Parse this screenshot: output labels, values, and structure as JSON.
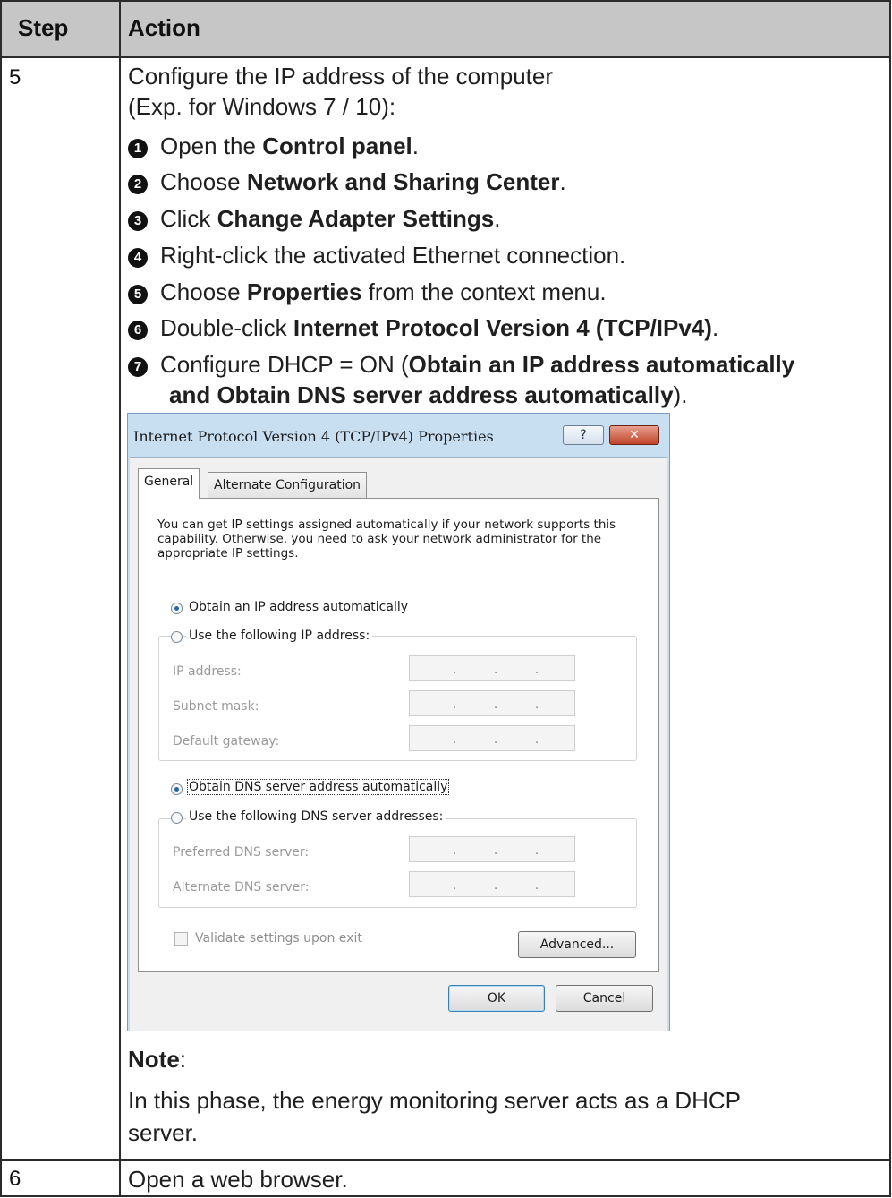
{
  "header": {
    "step": "Step",
    "action": "Action"
  },
  "rows": [
    {
      "step": "5",
      "intro": [
        "Configure the IP address of the computer",
        "(Exp. for Windows 7 / 10):"
      ],
      "items": [
        {
          "bullet": "1",
          "pre": "Open the ",
          "bold": "Control panel",
          "post": "."
        },
        {
          "bullet": "2",
          "pre": "Choose ",
          "bold": "Network and Sharing Center",
          "post": "."
        },
        {
          "bullet": "3",
          "pre": "Click ",
          "bold": "Change Adapter Settings",
          "post": "."
        },
        {
          "bullet": "4",
          "pre": "Right-click the activated Ethernet connection.",
          "bold": "",
          "post": ""
        },
        {
          "bullet": "5",
          "pre": "Choose ",
          "bold": "Properties",
          "post": " from the context menu."
        },
        {
          "bullet": "6",
          "pre": "Double-click ",
          "bold": "Internet Protocol Version 4 (TCP/IPv4)",
          "post": "."
        },
        {
          "bullet": "7",
          "pre": "Configure DHCP = ON (",
          "bold": "Obtain an IP address automatically",
          "post": ""
        }
      ],
      "item7_line2_bold": "and Obtain DNS server address automatically",
      "item7_line2_post": ").",
      "note_label": "Note",
      "note_colon": ":",
      "note_text": [
        "In this phase, the energy monitoring server acts as a DHCP",
        "server."
      ]
    },
    {
      "step": "6",
      "action": "Open a web browser."
    }
  ],
  "dialog": {
    "title": "Internet Protocol Version 4 (TCP/IPv4) Properties",
    "help_button": "?",
    "close_button": "✕",
    "tabs": [
      "General",
      "Alternate Configuration"
    ],
    "description": "You can get IP settings assigned automatically if your network supports this capability. Otherwise, you need to ask your network administrator for the appropriate IP settings.",
    "radio_obtain_ip": "Obtain an IP address automatically",
    "radio_use_ip": "Use the following IP address:",
    "ip_address_label": "IP address:",
    "subnet_mask_label": "Subnet mask:",
    "default_gateway_label": "Default gateway:",
    "radio_obtain_dns": "Obtain DNS server address automatically",
    "radio_use_dns": "Use the following DNS server addresses:",
    "preferred_dns_label": "Preferred DNS server:",
    "alternate_dns_label": "Alternate DNS server:",
    "ip_placeholder": ". . .",
    "validate_label": "Validate settings upon exit",
    "advanced_button": "Advanced...",
    "ok_button": "OK",
    "cancel_button": "Cancel"
  }
}
